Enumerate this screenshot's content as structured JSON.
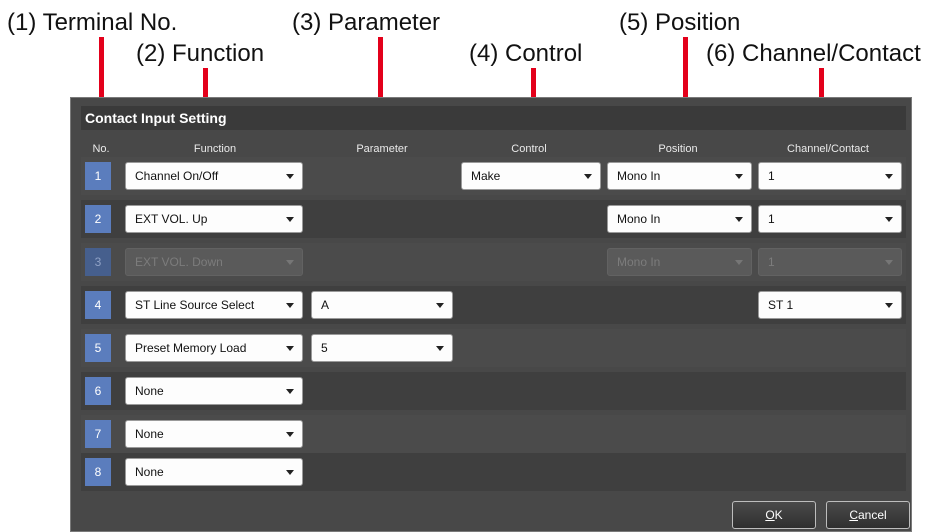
{
  "callouts": {
    "terminal_no": "(1) Terminal No.",
    "function": "(2) Function",
    "parameter": "(3) Parameter",
    "control": "(4) Control",
    "position": "(5) Position",
    "channel_contact": "(6) Channel/Contact"
  },
  "dialog": {
    "title": "Contact Input Setting",
    "columns": {
      "no": "No.",
      "function": "Function",
      "parameter": "Parameter",
      "control": "Control",
      "position": "Position",
      "channel_contact": "Channel/Contact"
    },
    "rows": [
      {
        "no": "1",
        "function": "Channel On/Off",
        "control": "Make",
        "position": "Mono In",
        "channel": "1"
      },
      {
        "no": "2",
        "function": "EXT VOL. Up",
        "position": "Mono In",
        "channel": "1"
      },
      {
        "no": "3",
        "function": "EXT VOL. Down",
        "position": "Mono In",
        "channel": "1",
        "disabled": true
      },
      {
        "no": "4",
        "function": "ST Line Source Select",
        "parameter": "A",
        "channel": "ST 1"
      },
      {
        "no": "5",
        "function": "Preset Memory Load",
        "parameter": "5"
      },
      {
        "no": "6",
        "function": "None"
      },
      {
        "no": "7",
        "function": "None"
      },
      {
        "no": "8",
        "function": "None"
      }
    ],
    "buttons": {
      "ok_prefix": "",
      "ok_mnemonic": "O",
      "ok_rest": "K",
      "cancel_prefix": "",
      "cancel_mnemonic": "C",
      "cancel_rest": "ancel"
    }
  },
  "colors": {
    "pointer": "#e3001b",
    "number_badge": "#5b7dbd",
    "dialog_bg": "#484848"
  }
}
